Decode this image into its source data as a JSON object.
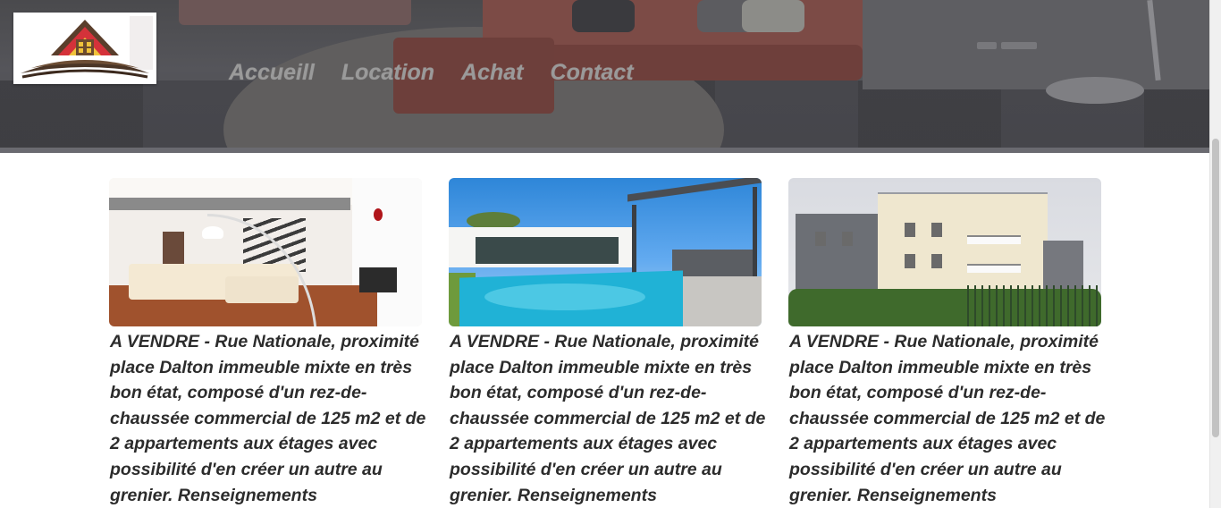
{
  "nav": {
    "items": [
      {
        "label": "Accueill"
      },
      {
        "label": "Location"
      },
      {
        "label": "Achat"
      },
      {
        "label": "Contact"
      }
    ]
  },
  "logo": {
    "icon": "house-logo-icon"
  },
  "listings": [
    {
      "image": "interior-living-room-photo",
      "description": "A VENDRE - Rue Nationale, proximité place Dalton immeuble mixte en très bon état, composé d'un rez-de-chaussée commercial de 125 m2 et de 2 appartements aux étages avec possibilité d'en créer un autre au grenier. Renseignements"
    },
    {
      "image": "pool-house-photo",
      "description": "A VENDRE - Rue Nationale, proximité place Dalton immeuble mixte en très bon état, composé d'un rez-de-chaussée commercial de 125 m2 et de 2 appartements aux étages avec possibilité d'en créer un autre au grenier. Renseignements"
    },
    {
      "image": "apartment-building-photo",
      "description": "A VENDRE - Rue Nationale, proximité place Dalton immeuble mixte en très bon état, composé d'un rez-de-chaussée commercial de 125 m2 et de 2 appartements aux étages avec possibilité d'en créer un autre au grenier. Renseignements"
    }
  ],
  "colors": {
    "nav_text": "#9a9a9a",
    "body_text": "#2c2c2c",
    "header_bg": "#4a4a4d"
  }
}
